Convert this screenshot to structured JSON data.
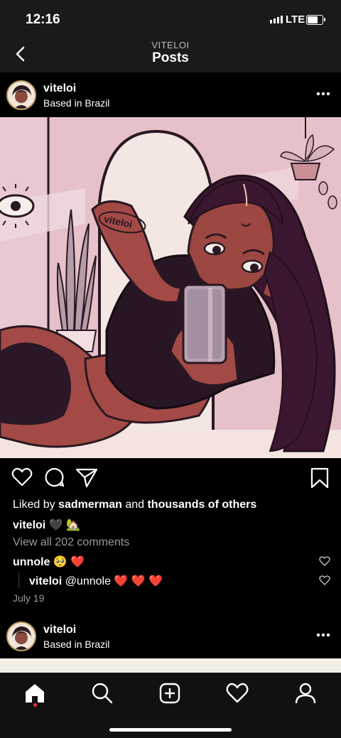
{
  "status_bar": {
    "time": "12:16",
    "network": "LTE"
  },
  "header": {
    "username": "VITELOI",
    "title": "Posts"
  },
  "post": {
    "username": "viteloi",
    "location": "Based in Brazil",
    "image_tattoo_text": "viteloi",
    "liked_by_prefix": "Liked by ",
    "liked_by_user": "sadmerman",
    "liked_by_mid": " and ",
    "liked_by_suffix": "thousands of others",
    "caption_user": "viteloi",
    "caption_text": "🖤 🏡",
    "view_comments": "View all 202 comments",
    "comments": [
      {
        "user": "unnole",
        "text": "🥺 ❤️"
      },
      {
        "user": "viteloi",
        "text": "@unnole ❤️ ❤️ ❤️"
      }
    ],
    "date": "July 19"
  },
  "next_post": {
    "username": "viteloi",
    "location": "Based in Brazil"
  },
  "colors": {
    "background": "#000000",
    "image_bg": "#e8c3cc",
    "accent_dot": "#e6353a",
    "avatar_ring": "#c0a060"
  },
  "icons": {
    "back": "chevron-left-icon",
    "more": "more-dots-icon",
    "like": "heart-icon",
    "comment": "comment-icon",
    "share": "send-icon",
    "save": "bookmark-icon",
    "home": "home-icon",
    "search": "search-icon",
    "add": "add-post-icon",
    "activity": "heart-icon",
    "profile": "profile-icon"
  }
}
